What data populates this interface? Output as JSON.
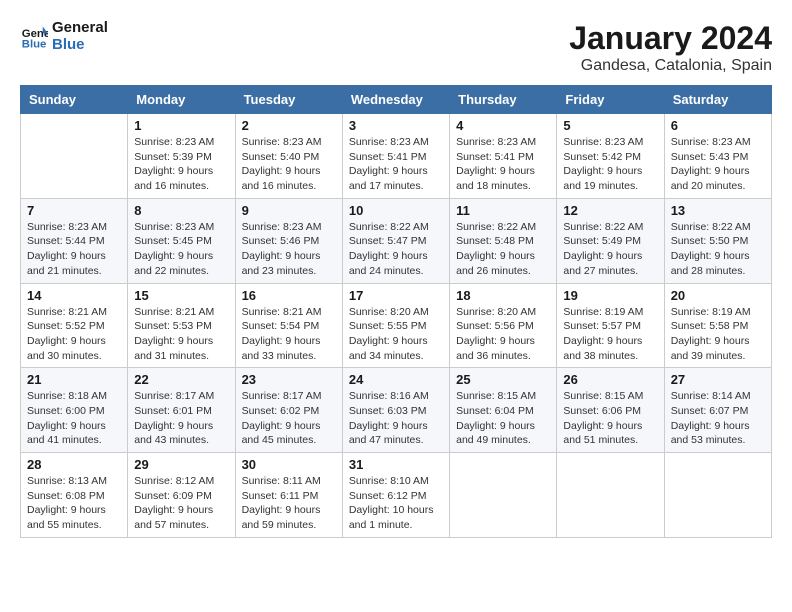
{
  "logo": {
    "text_general": "General",
    "text_blue": "Blue"
  },
  "title": "January 2024",
  "location": "Gandesa, Catalonia, Spain",
  "weekdays": [
    "Sunday",
    "Monday",
    "Tuesday",
    "Wednesday",
    "Thursday",
    "Friday",
    "Saturday"
  ],
  "weeks": [
    [
      {
        "day": "",
        "info": ""
      },
      {
        "day": "1",
        "info": "Sunrise: 8:23 AM\nSunset: 5:39 PM\nDaylight: 9 hours\nand 16 minutes."
      },
      {
        "day": "2",
        "info": "Sunrise: 8:23 AM\nSunset: 5:40 PM\nDaylight: 9 hours\nand 16 minutes."
      },
      {
        "day": "3",
        "info": "Sunrise: 8:23 AM\nSunset: 5:41 PM\nDaylight: 9 hours\nand 17 minutes."
      },
      {
        "day": "4",
        "info": "Sunrise: 8:23 AM\nSunset: 5:41 PM\nDaylight: 9 hours\nand 18 minutes."
      },
      {
        "day": "5",
        "info": "Sunrise: 8:23 AM\nSunset: 5:42 PM\nDaylight: 9 hours\nand 19 minutes."
      },
      {
        "day": "6",
        "info": "Sunrise: 8:23 AM\nSunset: 5:43 PM\nDaylight: 9 hours\nand 20 minutes."
      }
    ],
    [
      {
        "day": "7",
        "info": "Sunrise: 8:23 AM\nSunset: 5:44 PM\nDaylight: 9 hours\nand 21 minutes."
      },
      {
        "day": "8",
        "info": "Sunrise: 8:23 AM\nSunset: 5:45 PM\nDaylight: 9 hours\nand 22 minutes."
      },
      {
        "day": "9",
        "info": "Sunrise: 8:23 AM\nSunset: 5:46 PM\nDaylight: 9 hours\nand 23 minutes."
      },
      {
        "day": "10",
        "info": "Sunrise: 8:22 AM\nSunset: 5:47 PM\nDaylight: 9 hours\nand 24 minutes."
      },
      {
        "day": "11",
        "info": "Sunrise: 8:22 AM\nSunset: 5:48 PM\nDaylight: 9 hours\nand 26 minutes."
      },
      {
        "day": "12",
        "info": "Sunrise: 8:22 AM\nSunset: 5:49 PM\nDaylight: 9 hours\nand 27 minutes."
      },
      {
        "day": "13",
        "info": "Sunrise: 8:22 AM\nSunset: 5:50 PM\nDaylight: 9 hours\nand 28 minutes."
      }
    ],
    [
      {
        "day": "14",
        "info": "Sunrise: 8:21 AM\nSunset: 5:52 PM\nDaylight: 9 hours\nand 30 minutes."
      },
      {
        "day": "15",
        "info": "Sunrise: 8:21 AM\nSunset: 5:53 PM\nDaylight: 9 hours\nand 31 minutes."
      },
      {
        "day": "16",
        "info": "Sunrise: 8:21 AM\nSunset: 5:54 PM\nDaylight: 9 hours\nand 33 minutes."
      },
      {
        "day": "17",
        "info": "Sunrise: 8:20 AM\nSunset: 5:55 PM\nDaylight: 9 hours\nand 34 minutes."
      },
      {
        "day": "18",
        "info": "Sunrise: 8:20 AM\nSunset: 5:56 PM\nDaylight: 9 hours\nand 36 minutes."
      },
      {
        "day": "19",
        "info": "Sunrise: 8:19 AM\nSunset: 5:57 PM\nDaylight: 9 hours\nand 38 minutes."
      },
      {
        "day": "20",
        "info": "Sunrise: 8:19 AM\nSunset: 5:58 PM\nDaylight: 9 hours\nand 39 minutes."
      }
    ],
    [
      {
        "day": "21",
        "info": "Sunrise: 8:18 AM\nSunset: 6:00 PM\nDaylight: 9 hours\nand 41 minutes."
      },
      {
        "day": "22",
        "info": "Sunrise: 8:17 AM\nSunset: 6:01 PM\nDaylight: 9 hours\nand 43 minutes."
      },
      {
        "day": "23",
        "info": "Sunrise: 8:17 AM\nSunset: 6:02 PM\nDaylight: 9 hours\nand 45 minutes."
      },
      {
        "day": "24",
        "info": "Sunrise: 8:16 AM\nSunset: 6:03 PM\nDaylight: 9 hours\nand 47 minutes."
      },
      {
        "day": "25",
        "info": "Sunrise: 8:15 AM\nSunset: 6:04 PM\nDaylight: 9 hours\nand 49 minutes."
      },
      {
        "day": "26",
        "info": "Sunrise: 8:15 AM\nSunset: 6:06 PM\nDaylight: 9 hours\nand 51 minutes."
      },
      {
        "day": "27",
        "info": "Sunrise: 8:14 AM\nSunset: 6:07 PM\nDaylight: 9 hours\nand 53 minutes."
      }
    ],
    [
      {
        "day": "28",
        "info": "Sunrise: 8:13 AM\nSunset: 6:08 PM\nDaylight: 9 hours\nand 55 minutes."
      },
      {
        "day": "29",
        "info": "Sunrise: 8:12 AM\nSunset: 6:09 PM\nDaylight: 9 hours\nand 57 minutes."
      },
      {
        "day": "30",
        "info": "Sunrise: 8:11 AM\nSunset: 6:11 PM\nDaylight: 9 hours\nand 59 minutes."
      },
      {
        "day": "31",
        "info": "Sunrise: 8:10 AM\nSunset: 6:12 PM\nDaylight: 10 hours\nand 1 minute."
      },
      {
        "day": "",
        "info": ""
      },
      {
        "day": "",
        "info": ""
      },
      {
        "day": "",
        "info": ""
      }
    ]
  ]
}
